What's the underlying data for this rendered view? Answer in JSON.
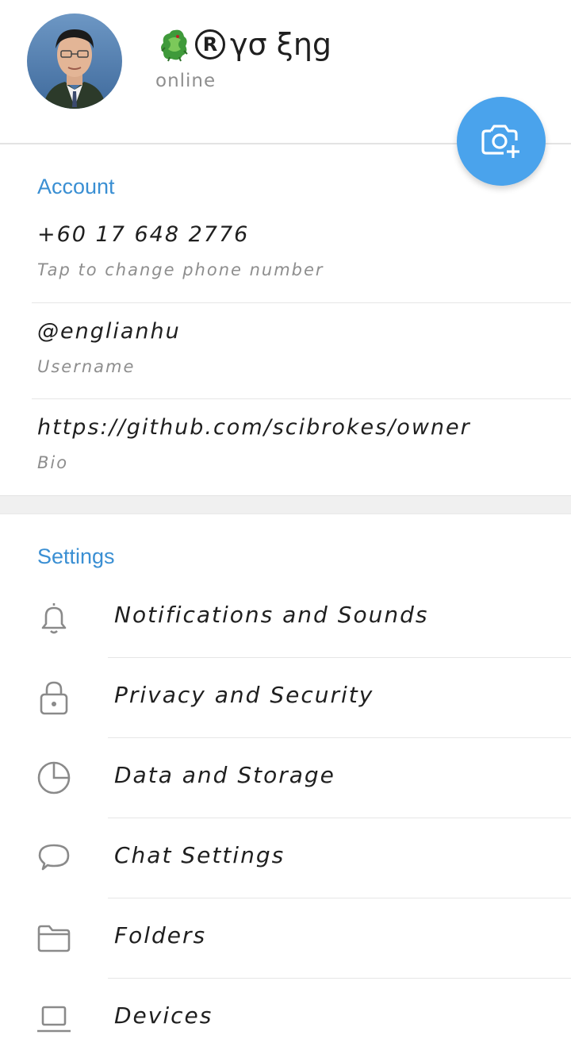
{
  "profile": {
    "name": "γσ ξηg",
    "status": "online",
    "registered_symbol": "R"
  },
  "account": {
    "section_title": "Account",
    "phone": {
      "value": "+60 17 648 2776",
      "caption": "Tap to change phone number"
    },
    "username": {
      "value": "@englianhu",
      "caption": "Username"
    },
    "bio": {
      "value": "https://github.com/scibrokes/owner",
      "caption": "Bio"
    }
  },
  "settings": {
    "section_title": "Settings",
    "items": [
      {
        "label": "Notifications and Sounds",
        "icon": "bell-icon"
      },
      {
        "label": "Privacy and Security",
        "icon": "lock-icon"
      },
      {
        "label": "Data and Storage",
        "icon": "pie-chart-icon"
      },
      {
        "label": "Chat Settings",
        "icon": "chat-bubble-icon"
      },
      {
        "label": "Folders",
        "icon": "folder-icon"
      },
      {
        "label": "Devices",
        "icon": "laptop-icon"
      }
    ]
  },
  "colors": {
    "accent": "#3a8fd3",
    "fab": "#4aa3ec",
    "text_primary": "#1f1f1f",
    "text_secondary": "#8e8e8e",
    "icon_gray": "#8a8a8a"
  }
}
